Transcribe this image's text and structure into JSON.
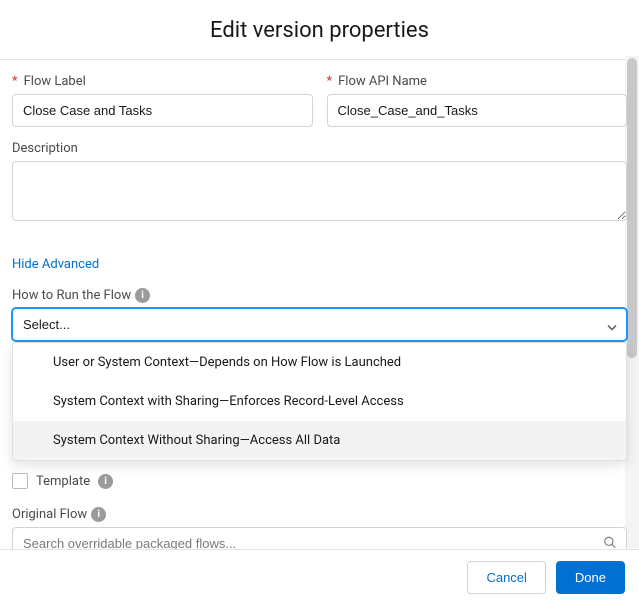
{
  "header": {
    "title": "Edit version properties"
  },
  "fields": {
    "flowLabel": {
      "label": "Flow Label",
      "required": "*",
      "value": "Close Case and Tasks"
    },
    "apiName": {
      "label": "Flow API Name",
      "required": "*",
      "value": "Close_Case_and_Tasks"
    },
    "description": {
      "label": "Description",
      "value": ""
    }
  },
  "advanced": {
    "toggleLabel": "Hide Advanced"
  },
  "howToRun": {
    "label": "How to Run the Flow",
    "value": "Select...",
    "options": [
      "User or System Context—Depends on How Flow is Launched",
      "System Context with Sharing—Enforces Record-Level Access",
      "System Context Without Sharing—Access All Data"
    ],
    "highlightedIndex": 2
  },
  "template": {
    "label": "Template",
    "checked": false
  },
  "originalFlow": {
    "label": "Original Flow",
    "placeholder": "Search overridable packaged flows..."
  },
  "footer": {
    "cancel": "Cancel",
    "done": "Done"
  }
}
